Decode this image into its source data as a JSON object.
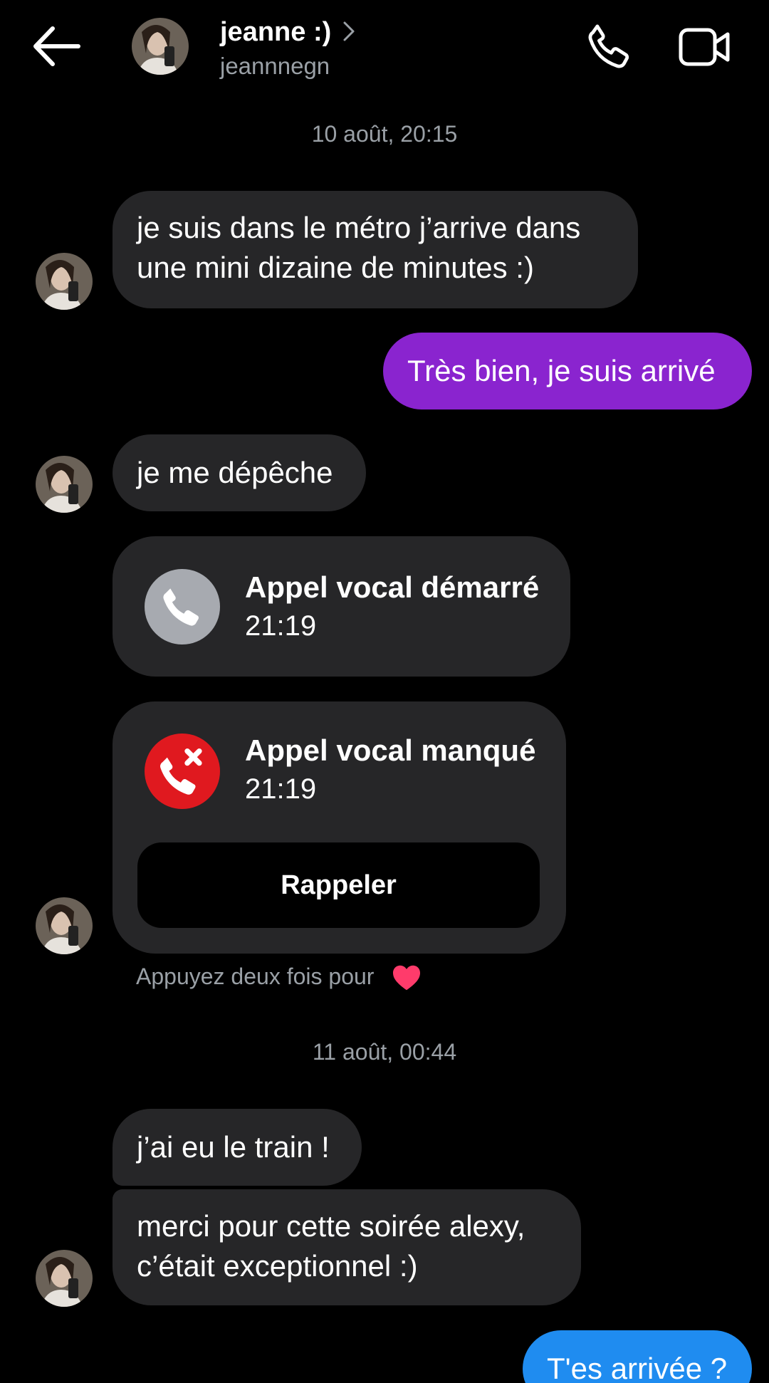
{
  "header": {
    "name": "jeanne :)",
    "username": "jeannnegn"
  },
  "timestamps": [
    "10 août, 20:15",
    "11 août, 00:44"
  ],
  "messages": {
    "m1": "je suis dans le métro j’arrive dans une mini dizaine de minutes :)",
    "m2": "Très bien, je suis arrivé",
    "m3": "je me dépêche",
    "m4": "j’ai eu le train !",
    "m5": "merci pour cette soirée alexy, c’était exceptionnel :)",
    "m6": "T'es arrivée ?"
  },
  "calls": {
    "started": {
      "title": "Appel vocal démarré",
      "time": "21:19"
    },
    "missed": {
      "title": "Appel vocal manqué",
      "time": "21:19",
      "callback_label": "Rappeler"
    }
  },
  "hint": "Appuyez deux fois pour",
  "icons": [
    "back-arrow-icon",
    "chevron-right-icon",
    "phone-icon",
    "video-camera-icon",
    "phone-call-icon",
    "missed-call-icon",
    "heart-icon"
  ],
  "colors": {
    "background": "#000000",
    "incoming_bubble": "#262628",
    "outgoing_bubble": "#8a24cf",
    "outgoing_bubble_latest": "#1f8cf0",
    "missed_call": "#e0191f",
    "started_call": "#a7aab0",
    "muted_text": "#9aa0a6",
    "heart": "#ff3b6b"
  }
}
